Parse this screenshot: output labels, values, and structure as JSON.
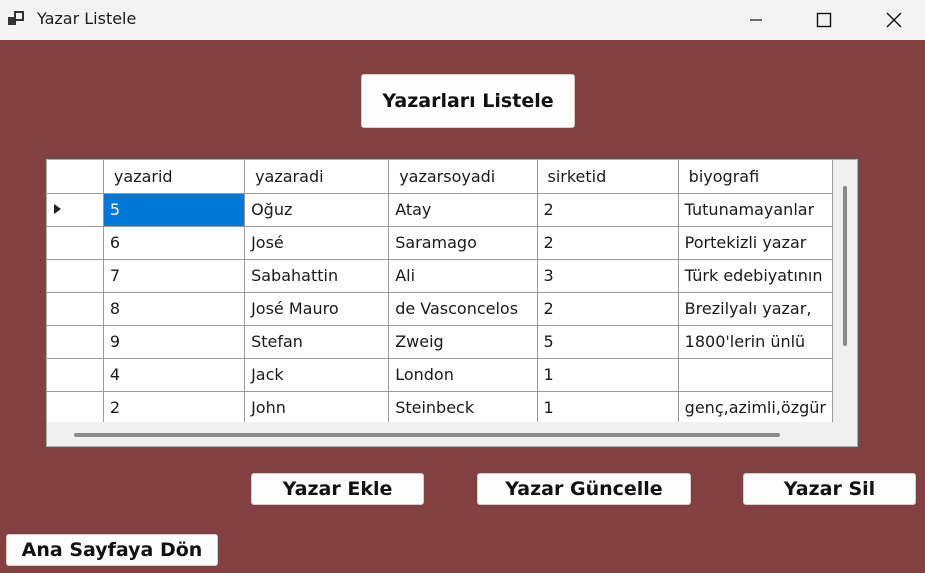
{
  "window": {
    "title": "Yazar Listele"
  },
  "buttons": {
    "list": "Yazarları  Listele",
    "add": "Yazar Ekle",
    "update": "Yazar Güncelle",
    "delete": "Yazar Sil",
    "home": "Ana Sayfaya Dön"
  },
  "grid": {
    "columns": [
      "yazarid",
      "yazaradi",
      "yazarsoyadi",
      "sirketid",
      "biyografi"
    ],
    "rows": [
      [
        "5",
        "Oğuz",
        "Atay",
        "2",
        "Tutunamayanlar"
      ],
      [
        "6",
        "José",
        "Saramago",
        "2",
        "Portekizli yazar"
      ],
      [
        "7",
        "Sabahattin",
        "Ali",
        "3",
        "Türk edebiyatının"
      ],
      [
        "8",
        "José Mauro",
        "de Vasconcelos",
        "2",
        "Brezilyalı yazar, "
      ],
      [
        "9",
        "Stefan",
        "Zweig",
        "5",
        "1800'lerin ünlü"
      ],
      [
        "4",
        "Jack",
        "London",
        "1",
        ""
      ],
      [
        "2",
        "John",
        "Steinbeck",
        "1",
        "genç,azimli,özgür"
      ]
    ],
    "selected_row": 0
  }
}
